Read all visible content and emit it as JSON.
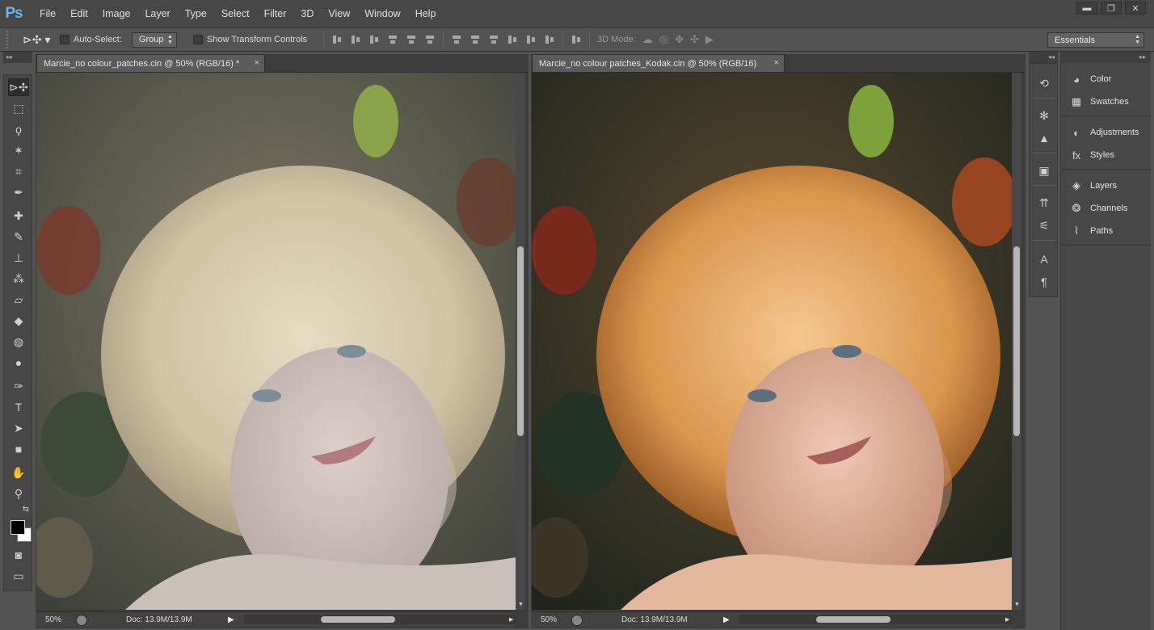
{
  "app": {
    "logo": "Ps"
  },
  "menu": [
    "File",
    "Edit",
    "Image",
    "Layer",
    "Type",
    "Select",
    "Filter",
    "3D",
    "View",
    "Window",
    "Help"
  ],
  "window_controls": {
    "minimize": "▬",
    "maximize": "❐",
    "close": "✕"
  },
  "options": {
    "tool_glyph": "⊳✣ ▾",
    "auto_select_label": "Auto-Select:",
    "auto_select_value": "Group",
    "show_transform_label": "Show Transform Controls",
    "mode_3d_label": "3D Mode:",
    "mode_3d_icons": [
      "☁",
      "◎",
      "✥",
      "✣",
      "▶"
    ],
    "workspace": "Essentials"
  },
  "tools": [
    "⊳✣",
    "⬚",
    "ϙ",
    "✶",
    "⌗",
    "✒",
    "✚",
    "✎",
    "⊥",
    "⁂",
    "▱",
    "◆",
    "◍",
    "●",
    "✑",
    "T",
    "➤",
    "■",
    "✋",
    "⚲"
  ],
  "tools_bottom": {
    "swap": "⇆",
    "quickmask": "◙",
    "screen": "▭"
  },
  "documents": [
    {
      "title": "Marcie_no colour_patches.cin @ 50% (RGB/16) *",
      "zoom": "50%",
      "doc_size": "Doc: 13.9M/13.9M",
      "variant": "cool"
    },
    {
      "title": "Marcie_no colour patches_Kodak.cin @ 50% (RGB/16)",
      "zoom": "50%",
      "doc_size": "Doc: 13.9M/13.9M",
      "variant": "warm"
    }
  ],
  "tab_close": "×",
  "dock_icons": [
    "⟲",
    "✻",
    "▲",
    "▣",
    "⇈",
    "⚟",
    "A",
    "¶"
  ],
  "panel_groups": [
    [
      {
        "label": "Color",
        "icon": "◕"
      },
      {
        "label": "Swatches",
        "icon": "▦"
      }
    ],
    [
      {
        "label": "Adjustments",
        "icon": "◐"
      },
      {
        "label": "Styles",
        "icon": "fx"
      }
    ],
    [
      {
        "label": "Layers",
        "icon": "◈"
      },
      {
        "label": "Channels",
        "icon": "❂"
      },
      {
        "label": "Paths",
        "icon": "⌇"
      }
    ]
  ],
  "colors": {
    "chrome": "#535353",
    "menubar": "#474747",
    "accent": "#6fb3e8"
  }
}
